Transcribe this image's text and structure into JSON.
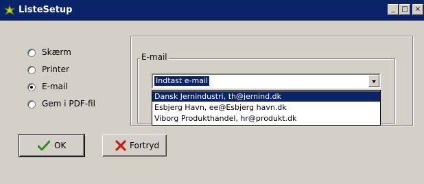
{
  "window": {
    "title": "ListeSetup",
    "controls": {
      "minimize": "_",
      "maximize": "□",
      "close": "×"
    }
  },
  "output_options": [
    {
      "label": "Skærm",
      "checked": false
    },
    {
      "label": "Printer",
      "checked": false
    },
    {
      "label": "E-mail",
      "checked": true
    },
    {
      "label": "Gem i PDF-fil",
      "checked": false
    }
  ],
  "email_group": {
    "label": "E-mail",
    "combo_value": "Indtast e-mail",
    "options": [
      {
        "text": "Dansk Jernindustri, th@jernind.dk",
        "selected": true
      },
      {
        "text": "Esbjerg Havn, ee@Esbjerg havn.dk",
        "selected": false
      },
      {
        "text": "Viborg Produkthandel, hr@produkt.dk",
        "selected": false
      }
    ]
  },
  "buttons": {
    "ok_label": "OK",
    "cancel_label": "Fortryd"
  },
  "colors": {
    "titlebar": "#0a246a",
    "selection": "#0a246a",
    "face": "#d4d0c8",
    "ok_check": "#2e8b1f",
    "cancel_x": "#cc1a1a"
  },
  "icons": {
    "app": "leaf-icon",
    "ok": "checkmark-icon",
    "cancel": "x-mark-icon"
  }
}
